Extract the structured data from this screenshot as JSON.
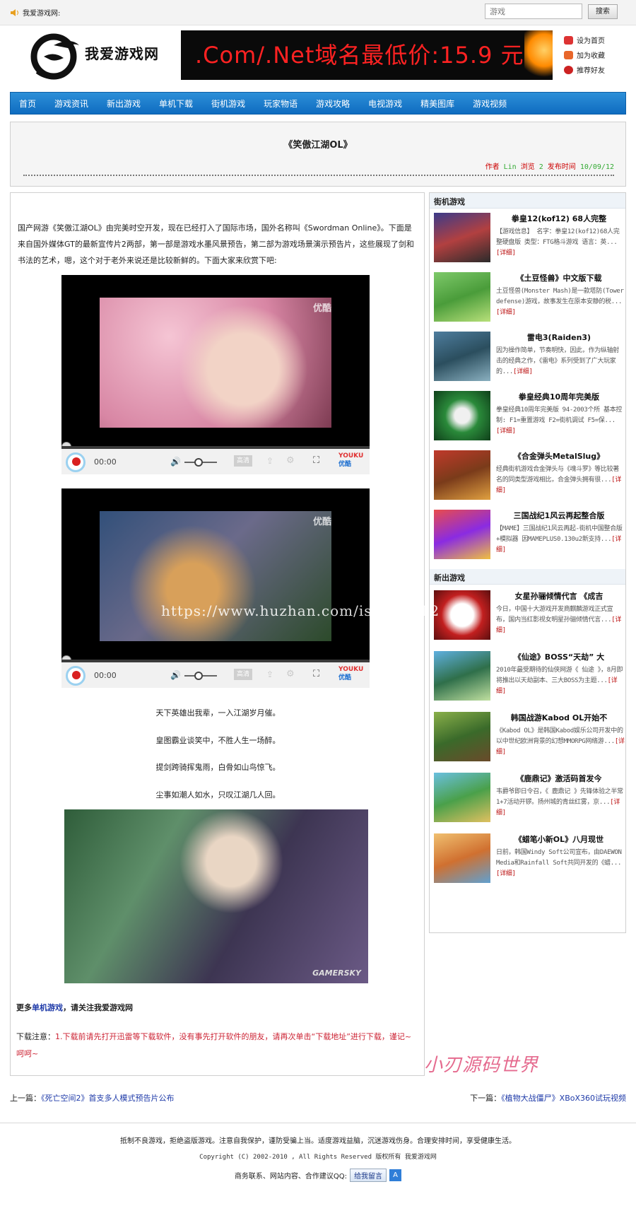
{
  "topbar": {
    "site_label": "我爱游戏网:",
    "search_value": "游戏",
    "search_button": "搜索"
  },
  "header": {
    "logo_text": "我爱游戏网",
    "banner_text": ".Com/.Net域名最低价:15.9 元",
    "links": [
      "设为首页",
      "加为收藏",
      "推荐好友"
    ]
  },
  "nav": [
    "首页",
    "游戏资讯",
    "新出游戏",
    "单机下载",
    "街机游戏",
    "玩家物语",
    "游戏攻略",
    "电视游戏",
    "精美图库",
    "游戏视频"
  ],
  "article": {
    "title": "《笑傲江湖OL》",
    "author_label": "作者",
    "author": "Lin",
    "views_label": "浏览",
    "views": "2",
    "date_label": "发布时间",
    "date": "10/09/12",
    "intro": "国产网游《笑傲江湖OL》由完美时空开发，现在已经打入了国际市场，国外名称叫《Swordman Online》。下面是来自国外媒体GT的最新宣传片2两部，第一部是游戏水墨风景预告，第二部为游戏场景演示预告片，这些展现了剑和书法的艺术，嗯，这个对于老外来说还是比较新鲜的。下面大家来欣赏下吧:",
    "video_watermark": "优酷",
    "video_time": "00:00",
    "video_hd": "高清",
    "video_brand": "YOUKU",
    "video_brand_cn": "优酷",
    "poem": [
      "天下英雄出我辈，一入江湖岁月催。",
      "皇图霸业谈笑中，不胜人生一场醉。",
      "提剑跨骑挥鬼雨，白骨如山鸟惊飞。",
      "尘事如潮人如水，只叹江湖几人回。"
    ],
    "photo_watermark": "GAMERSKY",
    "more_prefix": "更多",
    "more_link": "单机游戏",
    "more_suffix": "，请关注我爱游戏网",
    "note_prefix": "下载注意：",
    "note_text": "1.下载前请先打开迅雷等下载软件，没有事先打开软件的朋友，请再次单击“下载地址”进行下载，谨记~呵呵~",
    "watermark_overlay": "https://www.huzhan.com/ishop6012",
    "stamp": "小刃源码世界"
  },
  "sidebar": {
    "section1_title": "街机游戏",
    "section1": [
      {
        "title": "拳皇12(kof12) 68人完整",
        "desc": "【游戏信息】 名字：拳皇12(kof12)68人完整硬盘版 类型：FTG格斗游戏 语言：英...",
        "more": "[详细]"
      },
      {
        "title": "《土豆怪兽》中文版下载",
        "desc": "土豆怪兽(Monster Mash)是一款塔防(Tower defense)游戏，故事发生在原本安静的税...",
        "more": "[详细]"
      },
      {
        "title": "雷电3(Raiden3)",
        "desc": "因为操作简单，节奏明快，因此，作为纵轴射击的经典之作，《雷电》系列受到了广大玩家的...",
        "more": "[详细]"
      },
      {
        "title": "拳皇经典10周年完美版",
        "desc": "拳皇经典10周年完美版 94-2003个所 基本控制: F1=重置游戏 F2=街机调试 F5=保...",
        "more": "[详细]"
      },
      {
        "title": "《合金弹头MetalSlug》",
        "desc": "经典街机游戏合金弹头与《魂斗罗》等比较著名的同类型游戏相比，合金弹头拥有很...",
        "more": "[详细]"
      },
      {
        "title": "三国战纪1风云再起整合版",
        "desc": "【MAME】三国战纪1风云再起-街机中国整合版+模拟器 因MAMEPLUS0.130u2新支持...",
        "more": "[详细]"
      }
    ],
    "section2_title": "新出游戏",
    "section2": [
      {
        "title": "女星孙骊倾情代言 《成吉",
        "desc": "今日，中国十大游戏开发商麒麟游戏正式宣布，国内当红影视女明星孙骊倾情代言...",
        "more": "[详细]"
      },
      {
        "title": "《仙途》BOSS“天劫” 大",
        "desc": "2010年最受期待的仙侠网游《 仙途 》，8月即将推出以天劫副本、三大BOSS为主题...",
        "more": "[详细]"
      },
      {
        "title": "韩国战游Kabod OL开始不",
        "desc": "《Kabod OL》是韩国Kabod娱乐公司开发中的以中世纪欧洲背景的幻想MMORPG网络游...",
        "more": "[详细]"
      },
      {
        "title": "《鹿鼎记》激活码首发今",
        "desc": "韦爵爷即日令召，《 鹿鼎记 》先锋体验之半常1+7活动开锣。扬州城的青丝红雾，京...",
        "more": "[详细]"
      },
      {
        "title": "《蜡笔小新OL》八月现世",
        "desc": "日前，韩国Windy Soft公司宣布，由DAEWON Media和Rainfall Soft共同开发的《蜡...",
        "more": "[详细]"
      }
    ]
  },
  "prevnext": {
    "prev_label": "上一篇：",
    "prev_link": "《死亡空间2》首支多人模式预告片公布",
    "next_label": "下一篇：",
    "next_link": "《植物大战僵尸》XBoX360试玩视频"
  },
  "footer": {
    "line1": "抵制不良游戏，拒绝盗版游戏。注意自我保护，谨防受骗上当。适度游戏益脑，沉迷游戏伤身。合理安排时间，享受健康生活。",
    "line2": "Copyright (C) 2002-2010            , All Rights Reserved 版权所有 我爱游戏网",
    "line3": "商务联系、网站内容、合作建议QQ:",
    "qq_button": "给我留言"
  }
}
